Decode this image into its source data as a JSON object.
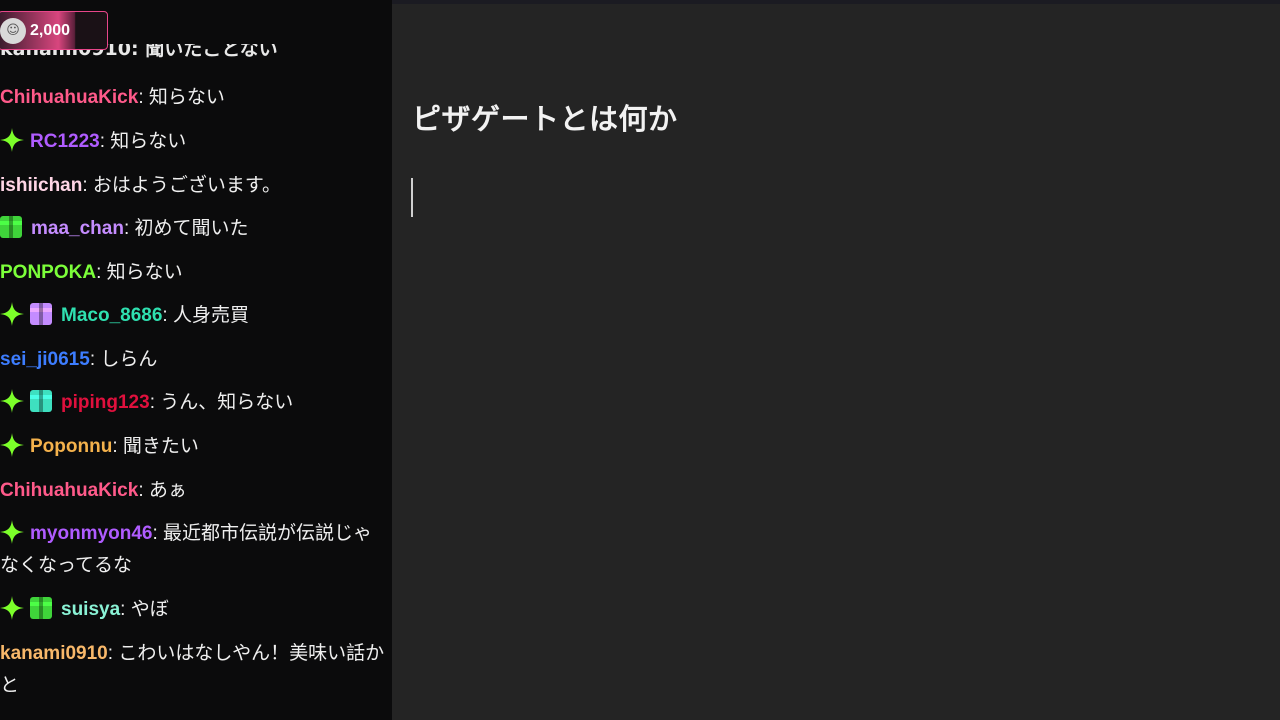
{
  "points": {
    "value": "2,000"
  },
  "chat": {
    "cut_line": "kanami0910: 聞いたことない",
    "messages": [
      {
        "user": "ChihuahuaKick",
        "color": "#ff5a8a",
        "text": "知らない",
        "badges": []
      },
      {
        "user": "RC1223",
        "color": "#b05cff",
        "text": "知らない",
        "badges": [
          "sparkle"
        ]
      },
      {
        "user": "ishiichan",
        "color": "#ffd6e6",
        "text": "おはようございます。",
        "badges": []
      },
      {
        "user": "maa_chan",
        "color": "#c58cff",
        "text": "初めて聞いた",
        "badges": [
          "gift-green"
        ]
      },
      {
        "user": "PONPOKA",
        "color": "#7cff3a",
        "text": "知らない",
        "badges": []
      },
      {
        "user": "Maco_8686",
        "color": "#2fe0b0",
        "text": "人身売買",
        "badges": [
          "sparkle",
          "gift-purple"
        ]
      },
      {
        "user": "sei_ji0615",
        "color": "#3d7dff",
        "text": "しらん",
        "badges": []
      },
      {
        "user": "piping123",
        "color": "#e0103d",
        "text": "うん、知らない",
        "badges": [
          "sparkle",
          "gift-teal"
        ]
      },
      {
        "user": "Poponnu",
        "color": "#f4b24c",
        "text": "聞きたい",
        "badges": [
          "sparkle"
        ]
      },
      {
        "user": "ChihuahuaKick",
        "color": "#ff5a8a",
        "text": "あぁ",
        "badges": []
      },
      {
        "user": "myonmyon46",
        "color": "#b05cff",
        "text": "最近都市伝説が伝説じゃなくなってるな",
        "badges": [
          "sparkle"
        ]
      },
      {
        "user": "suisya",
        "color": "#8af2d5",
        "text": "やぼ",
        "badges": [
          "sparkle",
          "gift-green"
        ]
      },
      {
        "user": "kanami0910",
        "color": "#f8b86a",
        "text": "こわいはなしやん！美味い話かと",
        "badges": []
      }
    ]
  },
  "editor": {
    "title": "ピザゲートとは何か"
  },
  "colors": {
    "sparkle": "#7cff2a",
    "gift-green": "#3fd43a",
    "gift-purple": "#c48cff",
    "gift-teal": "#3ee0c0"
  }
}
